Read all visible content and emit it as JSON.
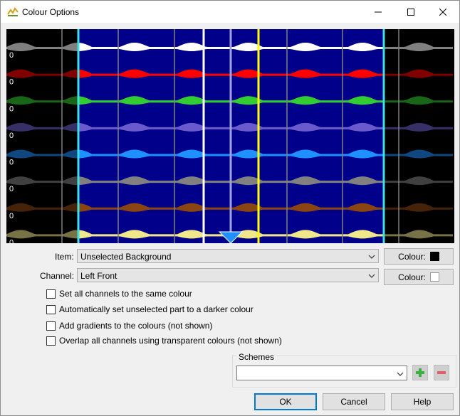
{
  "window": {
    "title": "Colour Options"
  },
  "preview": {
    "channel_value": "0",
    "channel_count": 8
  },
  "item": {
    "label": "Item:",
    "value": "Unselected Background",
    "colour_label": "Colour:",
    "colour": "#000000"
  },
  "channel": {
    "label": "Channel:",
    "value": "Left Front",
    "colour_label": "Colour:",
    "colour": "#ffffff"
  },
  "options": [
    {
      "label": "Set all channels to the same colour",
      "checked": false
    },
    {
      "label": "Automatically set unselected part to a darker colour",
      "checked": false
    },
    {
      "label": "Add gradients to the colours (not shown)",
      "checked": false
    },
    {
      "label": "Overlap all channels using transparent colours (not shown)",
      "checked": false
    }
  ],
  "schemes": {
    "title": "Schemes",
    "value": ""
  },
  "buttons": {
    "ok": "OK",
    "cancel": "Cancel",
    "help": "Help"
  },
  "colors": {
    "selected_background": "#00008b",
    "channels": [
      "#ffffff",
      "#ff0000",
      "#32cd32",
      "#6a5acd",
      "#1e90ff",
      "#808080",
      "#8b4513",
      "#f0e68c"
    ],
    "dark_channels": [
      "#808080",
      "#800000",
      "#196619",
      "#353066",
      "#0f4880",
      "#404040",
      "#452209",
      "#787346"
    ],
    "cursor_marker": "#1e90ff",
    "selection_edge": "#40e0e0",
    "play_line": "#ffff00"
  }
}
